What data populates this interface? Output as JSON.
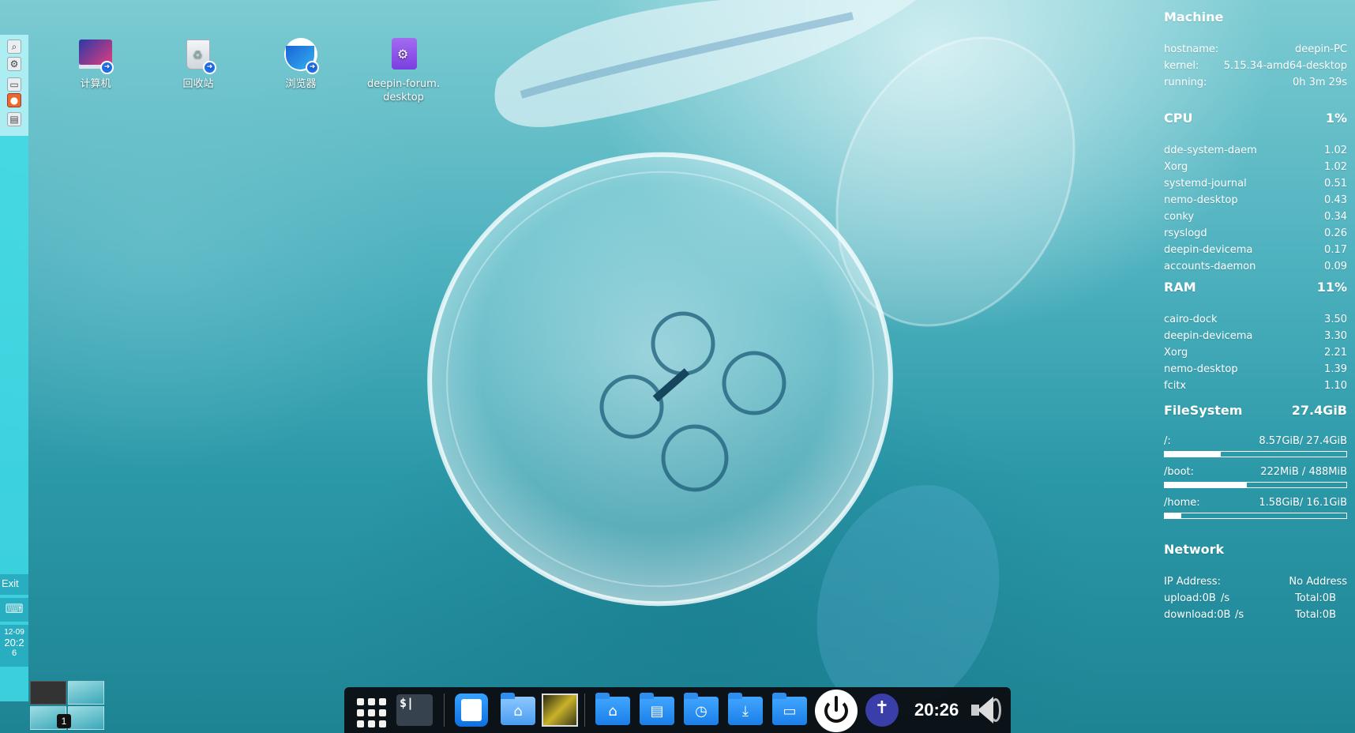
{
  "desktop": {
    "icons": [
      {
        "label": "计算机"
      },
      {
        "label": "回收站"
      },
      {
        "label": "浏览器"
      },
      {
        "label": "deepin-forum.",
        "label2": "desktop"
      }
    ]
  },
  "left_panel": {
    "launchers": [
      "magnifier-icon",
      "gear-icon",
      "drive-icon",
      "firefox-icon",
      "document-icon"
    ],
    "exit_label": "Exit",
    "keyboard_icon": "keyboard-icon",
    "clock": {
      "date": "12-09",
      "time": "20:2",
      "suffix": "6"
    }
  },
  "pager": {
    "current_workspace": "1"
  },
  "conky": {
    "machine": {
      "title": "Machine",
      "rows": [
        {
          "label": "hostname:",
          "value": "deepin-PC"
        },
        {
          "label": "kernel:",
          "value": "5.15.34-amd64-desktop"
        },
        {
          "label": "running:",
          "value": "0h 3m 29s"
        }
      ]
    },
    "cpu": {
      "title": "CPU",
      "total": "1%",
      "processes": [
        {
          "name": "dde-system-daem",
          "value": "1.02"
        },
        {
          "name": "Xorg",
          "value": "1.02"
        },
        {
          "name": "systemd-journal",
          "value": "0.51"
        },
        {
          "name": "nemo-desktop",
          "value": "0.43"
        },
        {
          "name": "conky",
          "value": "0.34"
        },
        {
          "name": "rsyslogd",
          "value": "0.26"
        },
        {
          "name": "deepin-devicema",
          "value": "0.17"
        },
        {
          "name": "accounts-daemon",
          "value": "0.09"
        }
      ]
    },
    "ram": {
      "title": "RAM",
      "total": "11%",
      "processes": [
        {
          "name": "cairo-dock",
          "value": "3.50"
        },
        {
          "name": "deepin-devicema",
          "value": "3.30"
        },
        {
          "name": "Xorg",
          "value": "2.21"
        },
        {
          "name": "nemo-desktop",
          "value": "1.39"
        },
        {
          "name": "fcitx",
          "value": "1.10"
        }
      ]
    },
    "filesystem": {
      "title": "FileSystem",
      "total": "27.4GiB",
      "mounts": [
        {
          "name": "/:",
          "usage": "8.57GiB/ 27.4GiB",
          "fraction": 0.31
        },
        {
          "name": "/boot:",
          "usage": "222MiB / 488MiB",
          "fraction": 0.45
        },
        {
          "name": "/home:",
          "usage": "1.58GiB/ 16.1GiB",
          "fraction": 0.09
        }
      ]
    },
    "network": {
      "title": "Network",
      "ip_label": "IP Address:",
      "ip_value": "No Address",
      "upload": {
        "label": "upload:0B",
        "unit": "/s",
        "total": "Total:0B"
      },
      "download": {
        "label": "download:0B",
        "unit": "/s",
        "total": "Total:0B"
      }
    }
  },
  "dock": {
    "items": [
      "app-grid-icon",
      "terminal-icon",
      "file-manager-icon",
      "home-folder-icon",
      "image-viewer-icon",
      "home-folder-icon",
      "documents-folder-icon",
      "recent-folder-icon",
      "downloads-folder-icon",
      "pictures-folder-icon",
      "power-icon",
      "accessibility-icon",
      "volume-icon"
    ],
    "terminal_glyph": "$|",
    "clock": "20:26"
  },
  "colors": {
    "panel": "#40dce6",
    "dock": "#0a0a0e",
    "folder_blue": "#1a7fe8"
  }
}
